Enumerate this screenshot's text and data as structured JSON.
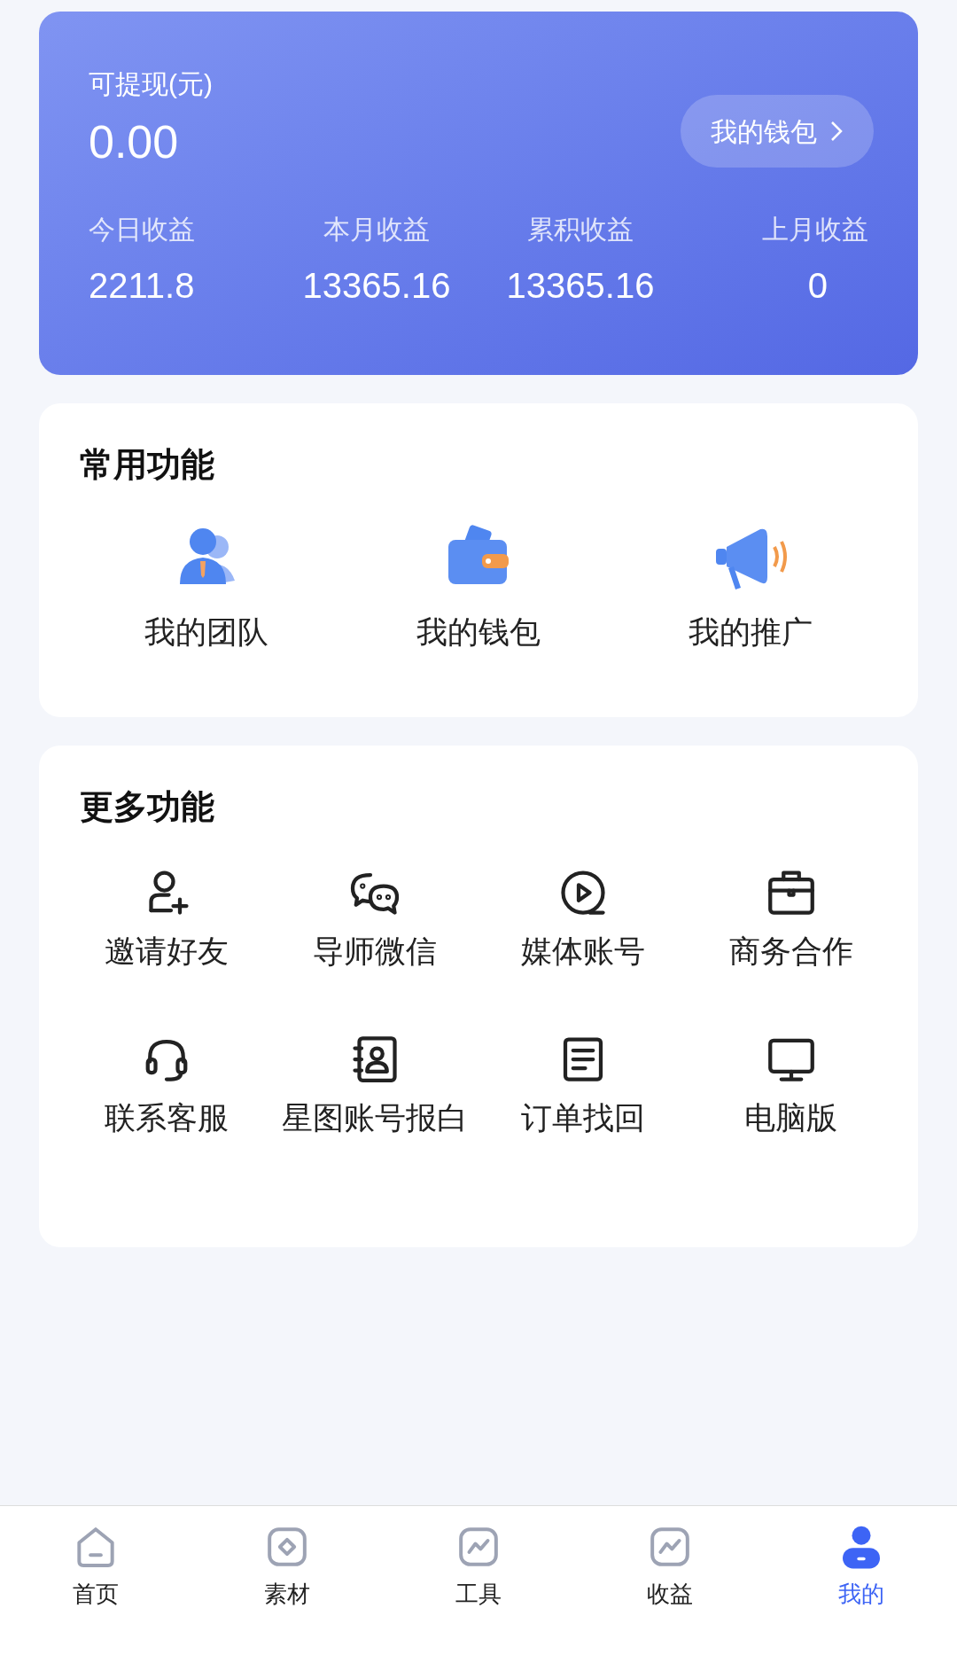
{
  "balance": {
    "label": "可提现(元)",
    "amount": "0.00",
    "wallet_button": "我的钱包"
  },
  "stats": [
    {
      "label": "今日收益",
      "value": "2211.8"
    },
    {
      "label": "本月收益",
      "value": "13365.16"
    },
    {
      "label": "累积收益",
      "value": "13365.16"
    },
    {
      "label": "上月收益",
      "value": "0"
    }
  ],
  "common": {
    "title": "常用功能",
    "items": [
      {
        "kind": "team",
        "label": "我的团队"
      },
      {
        "kind": "wallet",
        "label": "我的钱包"
      },
      {
        "kind": "promo",
        "label": "我的推广"
      }
    ]
  },
  "more": {
    "title": "更多功能",
    "items": [
      {
        "kind": "invite",
        "label": "邀请好友"
      },
      {
        "kind": "chat",
        "label": "导师微信"
      },
      {
        "kind": "media",
        "label": "媒体账号"
      },
      {
        "kind": "briefcase",
        "label": "商务合作"
      },
      {
        "kind": "headset",
        "label": "联系客服"
      },
      {
        "kind": "contact",
        "label": "星图账号报白"
      },
      {
        "kind": "document",
        "label": "订单找回"
      },
      {
        "kind": "monitor",
        "label": "电脑版"
      }
    ]
  },
  "nav": [
    {
      "kind": "home",
      "label": "首页",
      "selected": false
    },
    {
      "kind": "material",
      "label": "素材",
      "selected": false
    },
    {
      "kind": "chart",
      "label": "工具",
      "selected": false
    },
    {
      "kind": "chart",
      "label": "收益",
      "selected": false
    },
    {
      "kind": "user",
      "label": "我的",
      "selected": true
    }
  ]
}
